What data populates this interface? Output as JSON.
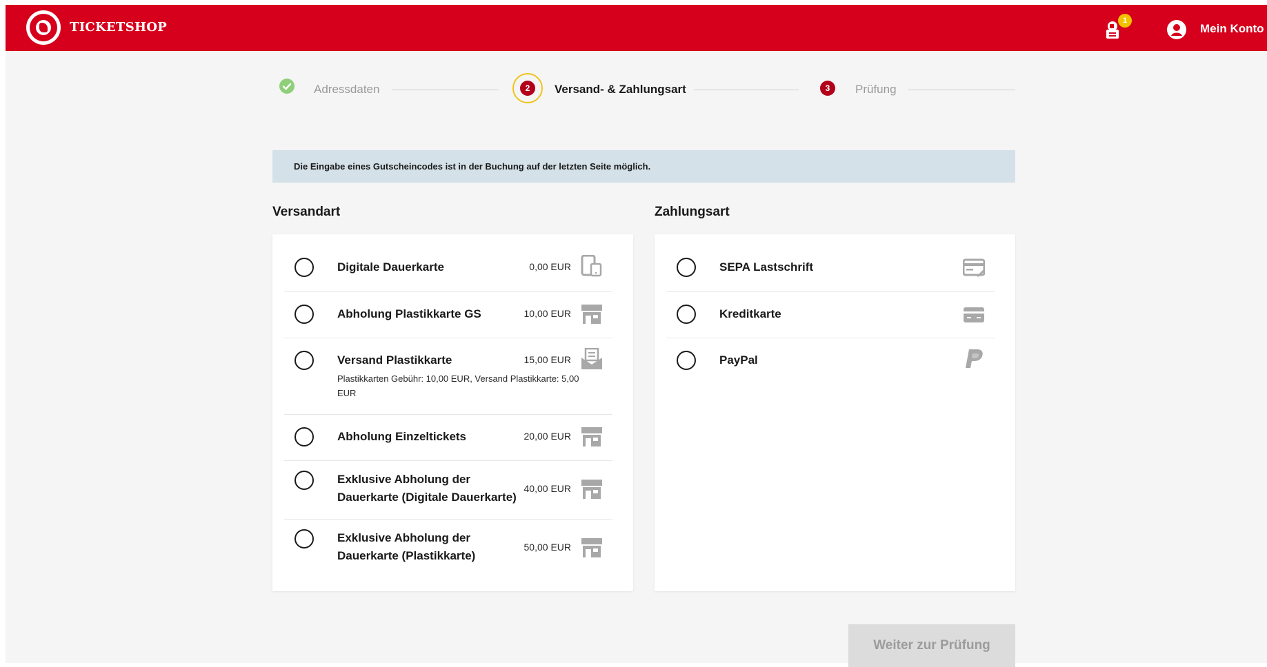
{
  "header": {
    "brand": "TICKETSHOP",
    "cart_count": "1",
    "account_label": "Mein Konto",
    "brand_color": "#d6001c"
  },
  "steps": [
    {
      "number": "",
      "label": "Adressdaten",
      "state": "done"
    },
    {
      "number": "2",
      "label": "Versand- & Zahlungsart",
      "state": "active"
    },
    {
      "number": "3",
      "label": "Prüfung",
      "state": "upcoming"
    }
  ],
  "info_banner": "Die Eingabe eines Gutscheincodes ist in der Buchung auf der letzten Seite möglich.",
  "shipping": {
    "title": "Versandart",
    "options": [
      {
        "label": "Digitale Dauerkarte",
        "price": "0,00 EUR",
        "icon": "mobile-device-icon"
      },
      {
        "label": "Abholung Plastikkarte GS",
        "price": "10,00 EUR",
        "icon": "store-icon"
      },
      {
        "label": "Versand Plastikkarte",
        "sub": "Plastikkarten Gebühr: 10,00 EUR, Versand Plastikkarte: 5,00 EUR",
        "price": "15,00 EUR",
        "icon": "envelope-icon"
      },
      {
        "label": "Abholung Einzeltickets",
        "price": "20,00 EUR",
        "icon": "store-icon"
      },
      {
        "label_line1": "Exklusive Abholung der",
        "label_line2": "Dauerkarte (Digitale Dauerkarte)",
        "price": "40,00 EUR",
        "icon": "store-icon"
      },
      {
        "label_line1": "Exklusive Abholung der",
        "label_line2": "Dauerkarte (Plastikkarte)",
        "price": "50,00 EUR",
        "icon": "store-icon"
      }
    ]
  },
  "payment": {
    "title": "Zahlungsart",
    "options": [
      {
        "label": "SEPA Lastschrift",
        "icon": "direct-debit-icon"
      },
      {
        "label": "Kreditkarte",
        "icon": "credit-card-icon"
      },
      {
        "label": "PayPal",
        "icon": "paypal-icon"
      }
    ]
  },
  "next_button": "Weiter zur Prüfung"
}
